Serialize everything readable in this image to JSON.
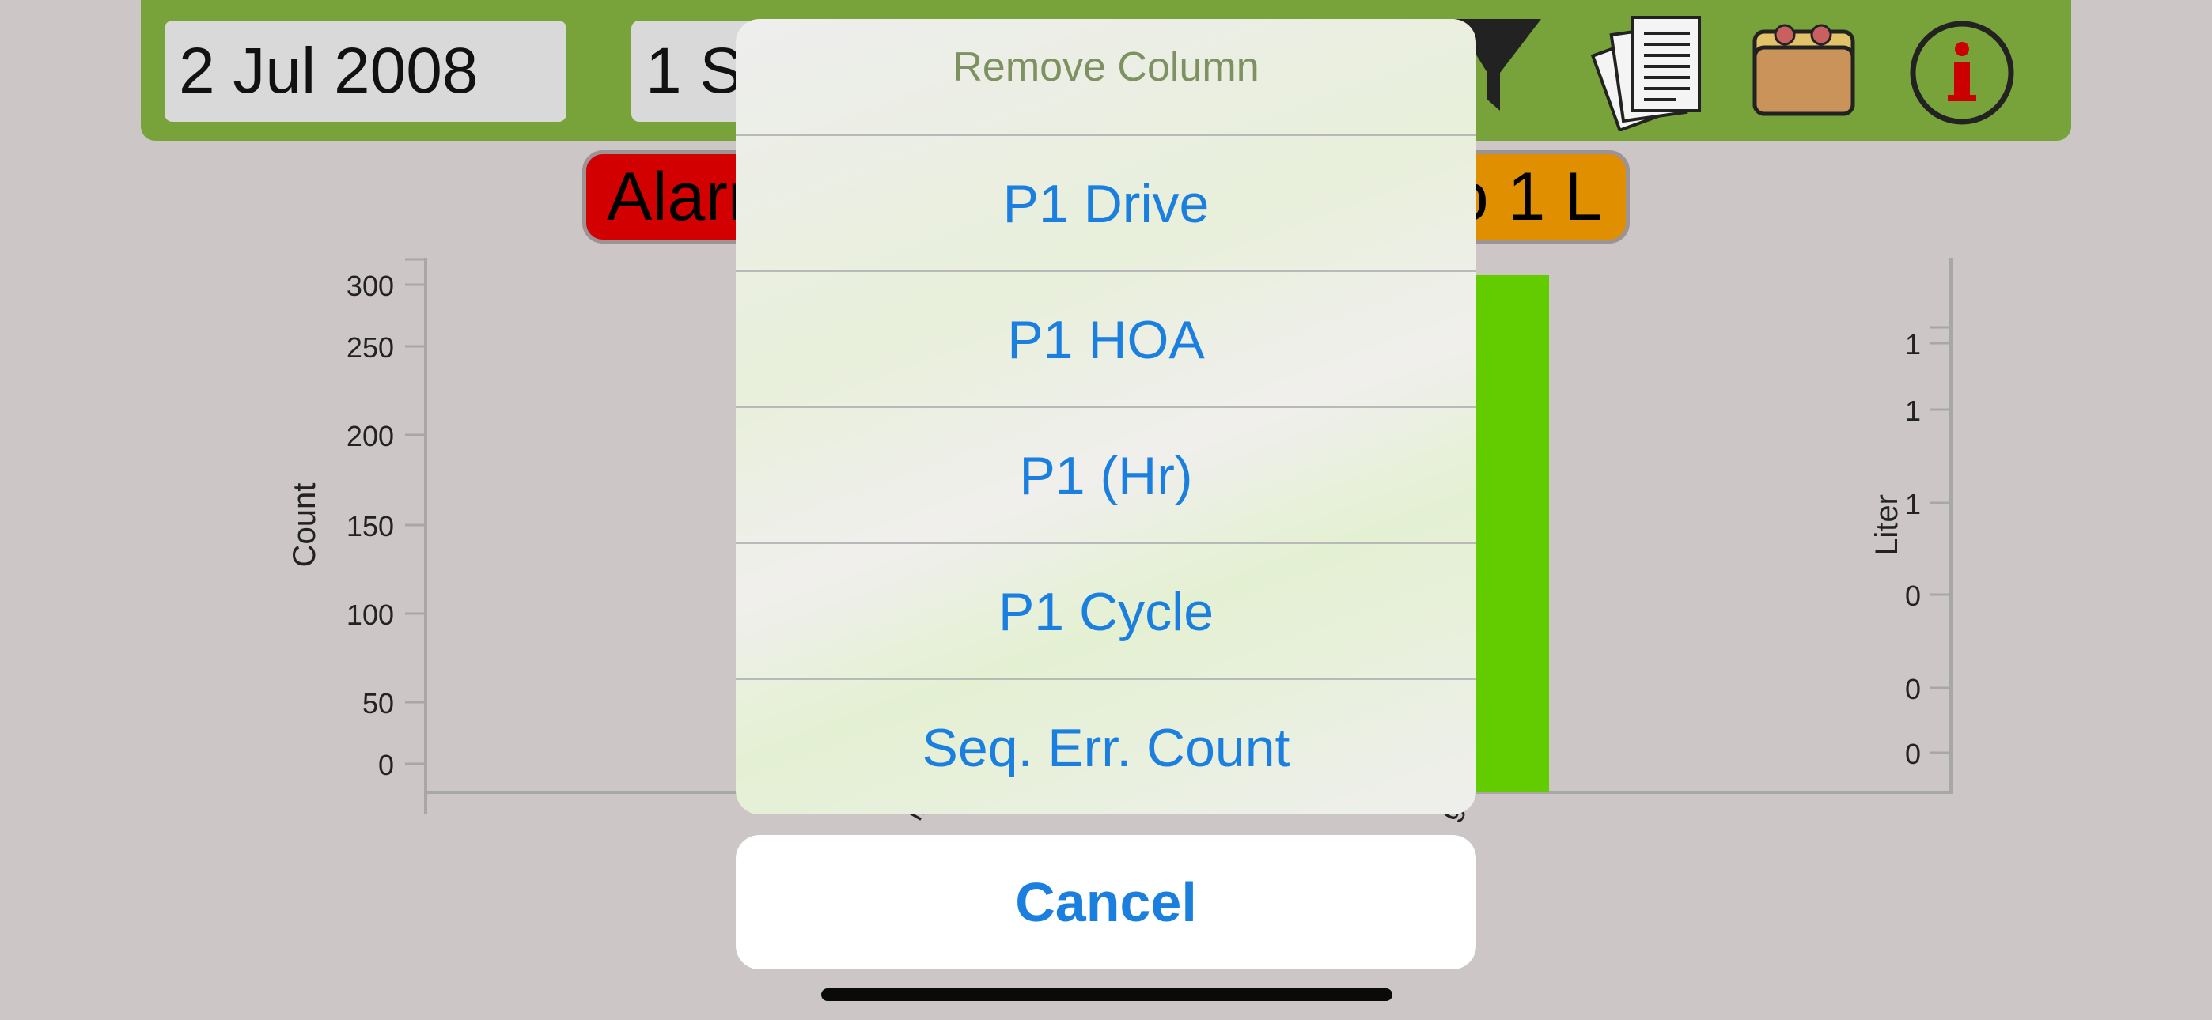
{
  "toolbar": {
    "date": "2 Jul 2008",
    "period": "1 S",
    "icons": [
      "filter-icon",
      "documents-icon",
      "folder-icon",
      "info-icon"
    ]
  },
  "chips": {
    "alarm_label": "Alarn",
    "pump_label": "o 1 L",
    "alarm_color": "#d20000",
    "pump_color": "#e08f00"
  },
  "chart_data": {
    "type": "bar",
    "ylabel": "Count",
    "ylabel_right": "Liter",
    "y_ticks_left": [
      "300",
      "250",
      "200",
      "150",
      "100",
      "50",
      "0"
    ],
    "y_ticks_right": [
      "1",
      "1",
      "1",
      "0",
      "0",
      "0"
    ],
    "x_tick_fragments": [
      "il",
      "g"
    ],
    "series": [
      {
        "values": [
          300
        ],
        "color": "#62cc00"
      }
    ],
    "ylim": [
      0,
      300
    ]
  },
  "action_sheet": {
    "title": "Remove Column",
    "items": [
      "P1 Drive",
      "P1 HOA",
      "P1 (Hr)",
      "P1 Cycle",
      "Seq. Err. Count"
    ],
    "cancel_label": "Cancel"
  }
}
